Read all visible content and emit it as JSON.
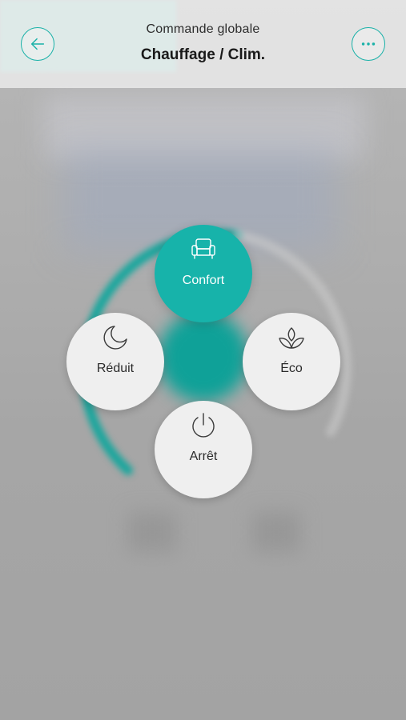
{
  "header": {
    "subtitle": "Commande globale",
    "title": "Chauffage / Clim.",
    "back_icon": "arrow-left-icon",
    "more_icon": "more-horizontal-icon"
  },
  "modes": [
    {
      "id": "confort",
      "label": "Confort",
      "icon": "sofa-icon",
      "active": true
    },
    {
      "id": "reduit",
      "label": "Réduit",
      "icon": "moon-icon",
      "active": false
    },
    {
      "id": "eco",
      "label": "Éco",
      "icon": "leaf-icon",
      "active": false
    },
    {
      "id": "arret",
      "label": "Arrêt",
      "icon": "power-icon",
      "active": false
    }
  ],
  "colors": {
    "accent": "#17b3aa",
    "button_bg": "#efefef",
    "overlay": "#a6a6a6"
  }
}
